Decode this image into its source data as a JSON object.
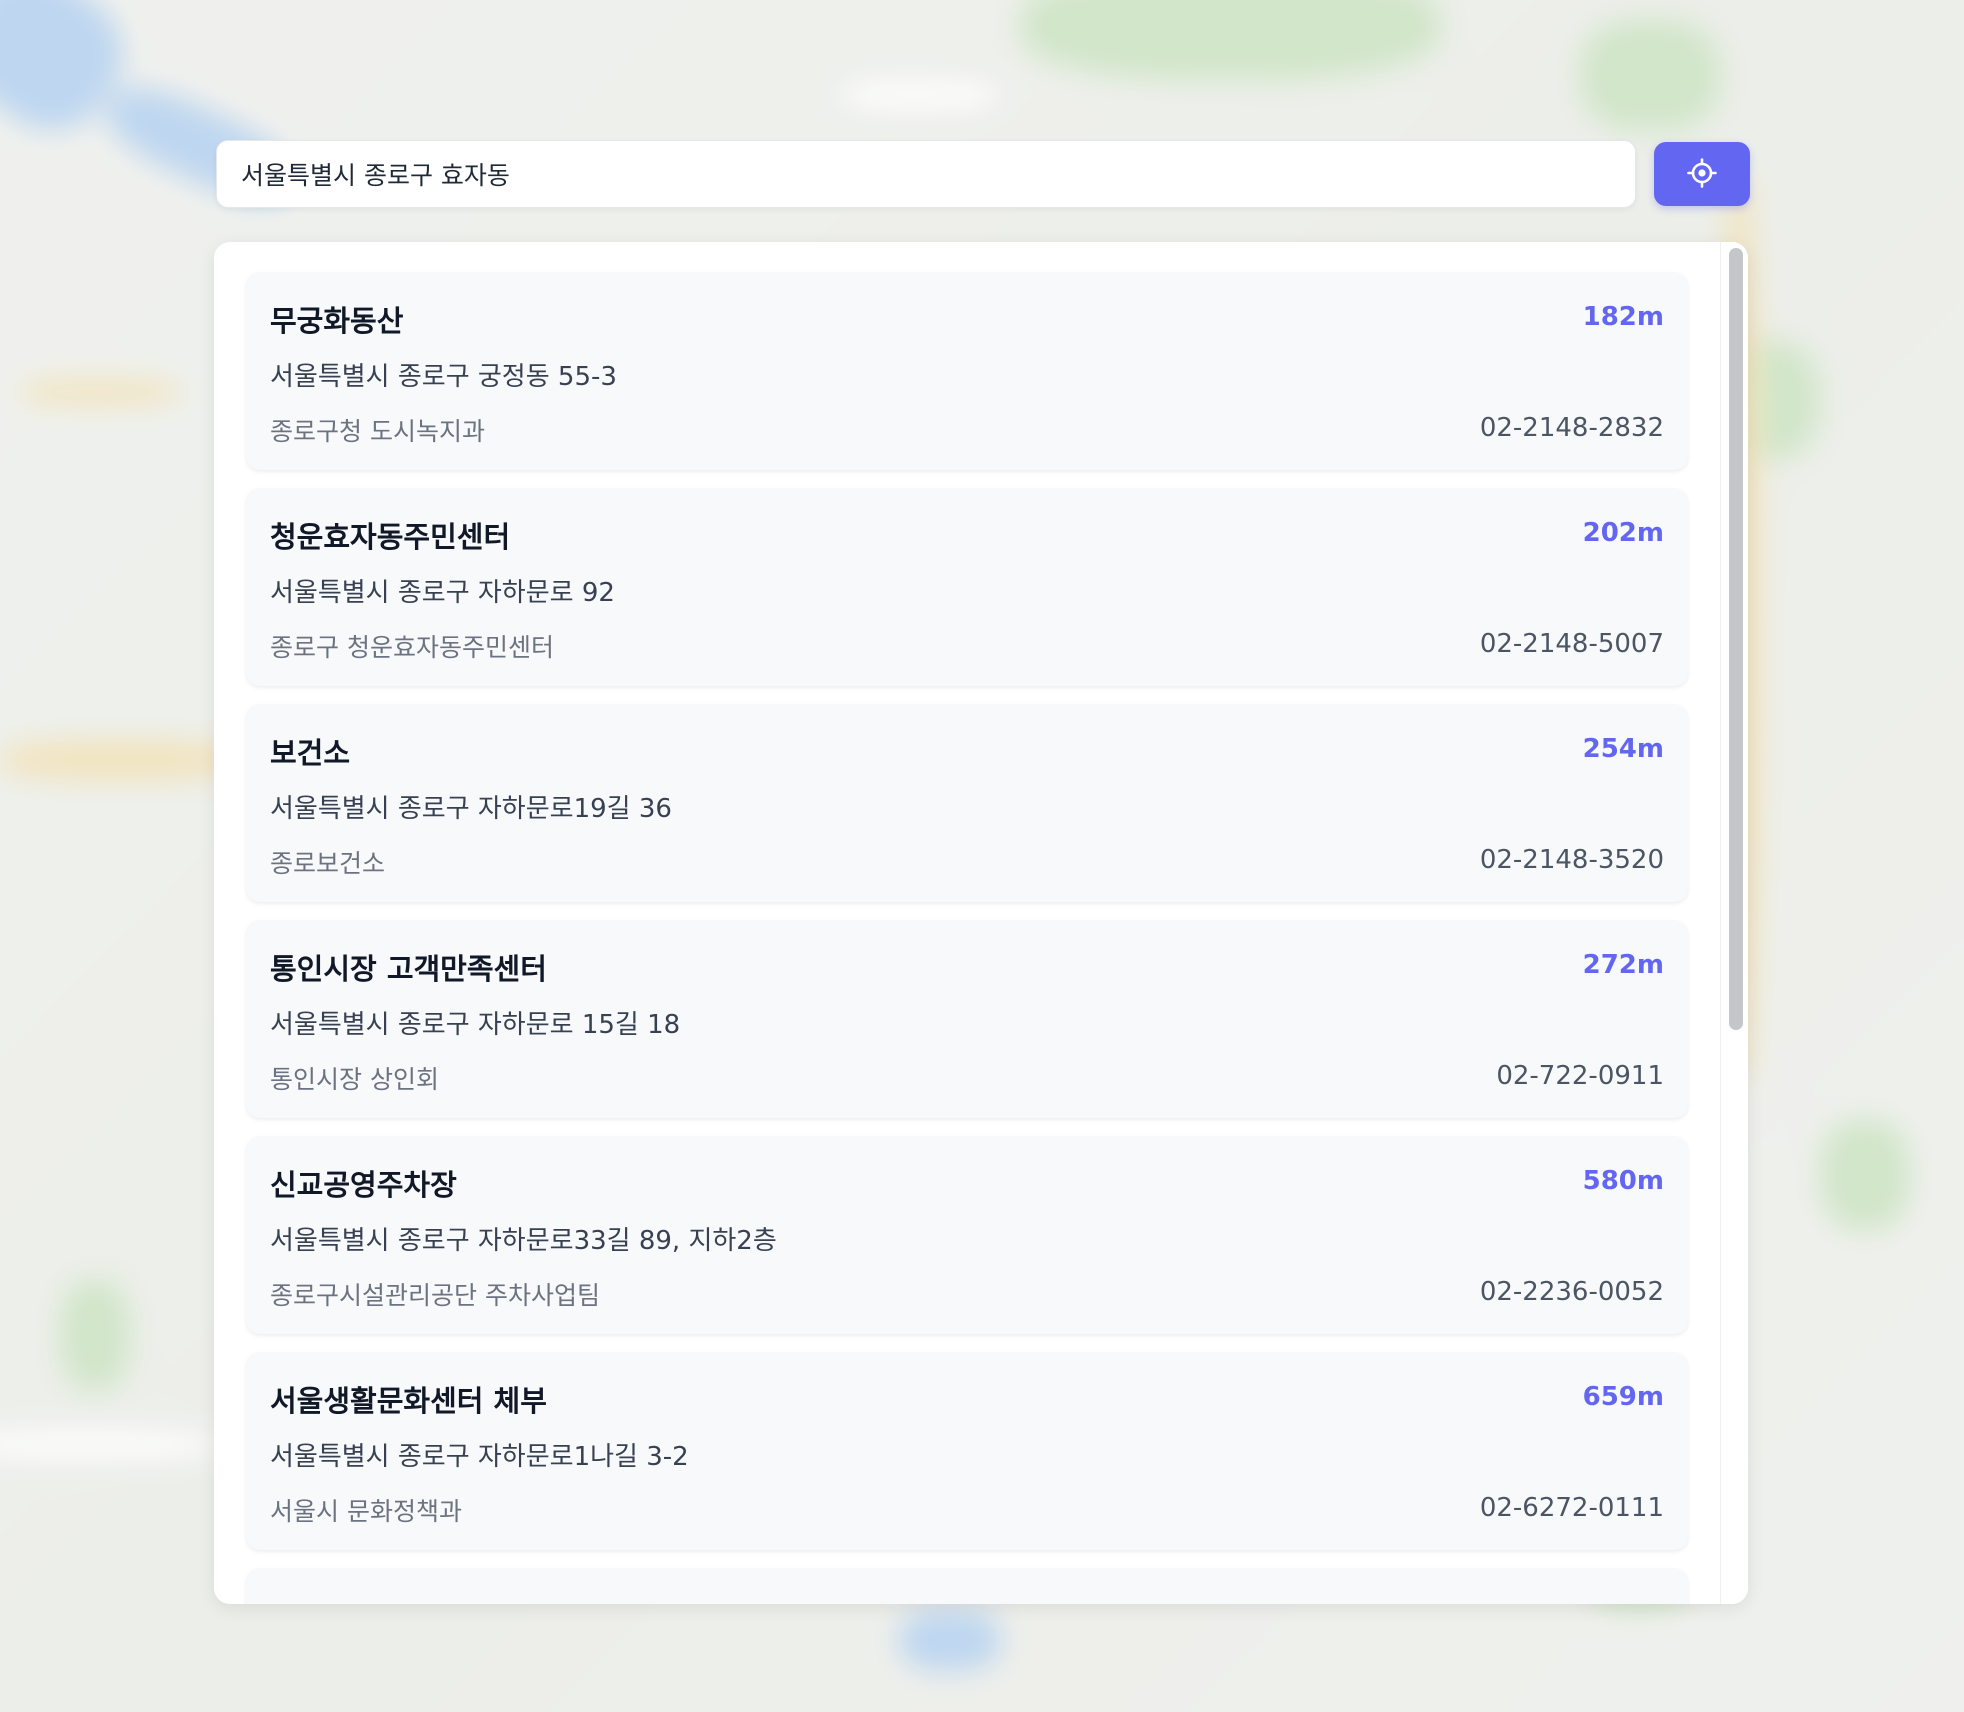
{
  "search": {
    "value": "서울특별시 종로구 효자동"
  },
  "locate_button": {
    "icon": "crosshair-icon",
    "color": "#6366f1"
  },
  "colors": {
    "accent": "#6366f1",
    "card_background": "#f8f9fb",
    "panel_background": "#ffffff"
  },
  "results": [
    {
      "name": "무궁화동산",
      "distance": "182m",
      "address": "서울특별시 종로구 궁정동 55-3",
      "agency": "종로구청 도시녹지과",
      "phone": "02-2148-2832"
    },
    {
      "name": "청운효자동주민센터",
      "distance": "202m",
      "address": "서울특별시 종로구 자하문로 92",
      "agency": "종로구 청운효자동주민센터",
      "phone": "02-2148-5007"
    },
    {
      "name": "보건소",
      "distance": "254m",
      "address": "서울특별시 종로구 자하문로19길 36",
      "agency": "종로보건소",
      "phone": "02-2148-3520"
    },
    {
      "name": "통인시장 고객만족센터",
      "distance": "272m",
      "address": "서울특별시 종로구 자하문로 15길 18",
      "agency": "통인시장 상인회",
      "phone": "02-722-0911"
    },
    {
      "name": "신교공영주차장",
      "distance": "580m",
      "address": "서울특별시 종로구 자하문로33길 89, 지하2층",
      "agency": "종로구시설관리공단 주차사업팀",
      "phone": "02-2236-0052"
    },
    {
      "name": "서울생활문화센터 체부",
      "distance": "659m",
      "address": "서울특별시 종로구 자하문로1나길 3-2",
      "agency": "서울시 문화정책과",
      "phone": "02-6272-0111"
    }
  ]
}
